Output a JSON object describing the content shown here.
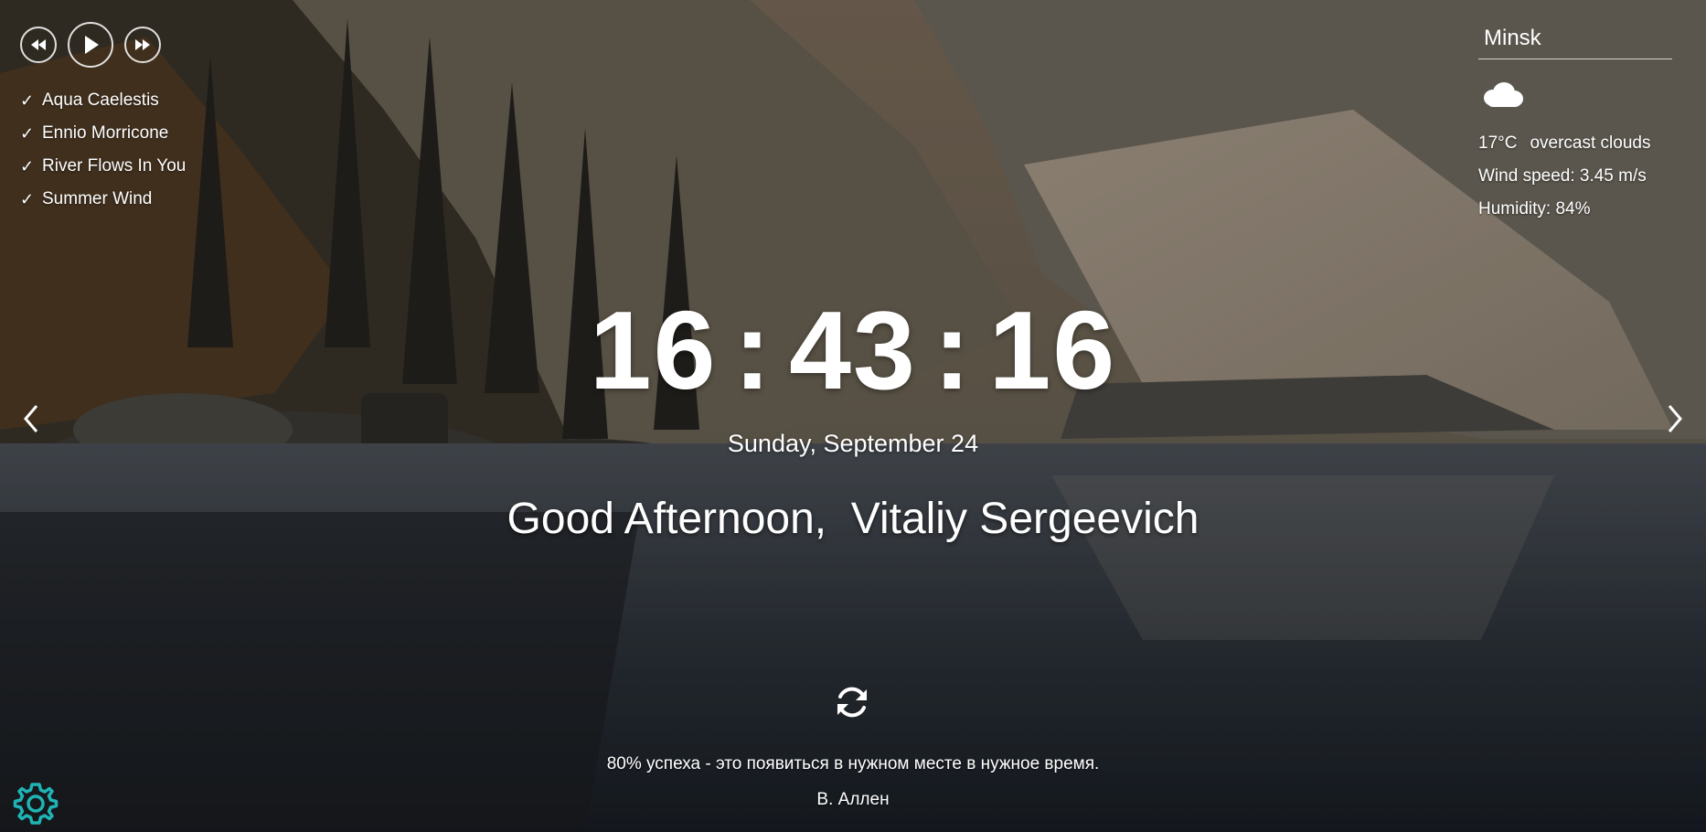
{
  "player": {
    "controls": [
      {
        "icon": "rewind-icon",
        "label": "Previous"
      },
      {
        "icon": "play-icon",
        "label": "Play"
      },
      {
        "icon": "fast-forward-icon",
        "label": "Next"
      }
    ],
    "playlist": [
      {
        "title": "Aqua Caelestis",
        "check": "✓"
      },
      {
        "title": "Ennio Morricone",
        "check": "✓"
      },
      {
        "title": "River Flows In You",
        "check": "✓"
      },
      {
        "title": "Summer Wind",
        "check": "✓"
      }
    ]
  },
  "weather": {
    "city": "Minsk",
    "icon": "cloud-icon",
    "temperature": "17°C",
    "description": "overcast clouds",
    "wind": "Wind speed: 3.45 m/s",
    "humidity": "Humidity: 84%"
  },
  "clock": {
    "hours": "16",
    "minutes": "43",
    "seconds": "16",
    "separator": ":"
  },
  "date": "Sunday, September 24",
  "greeting": "Good Afternoon,  Vitaliy Sergeevich",
  "quote": {
    "text": "80% успеха - это появиться в нужном месте в нужное время.",
    "author": "В. Аллен"
  },
  "nav": {
    "prev_icon": "chevron-left-icon",
    "next_icon": "chevron-right-icon"
  },
  "settings": {
    "icon": "gear-icon",
    "color": "#1fb5b5"
  }
}
